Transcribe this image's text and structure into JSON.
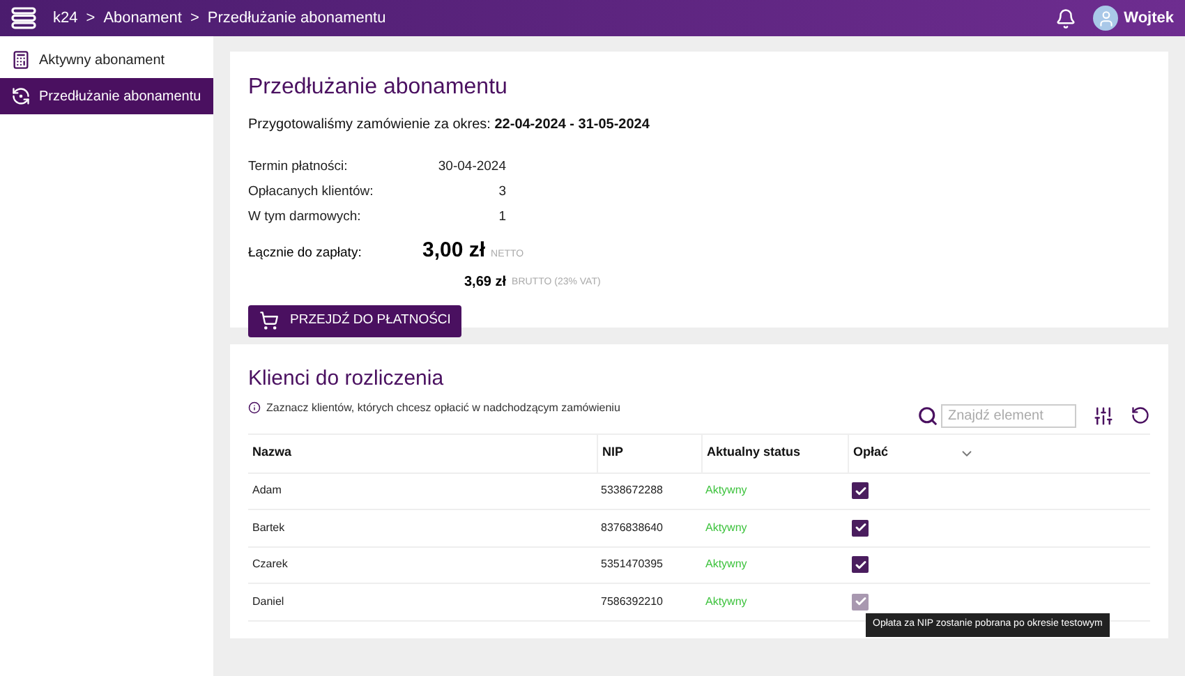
{
  "header": {
    "breadcrumbs": [
      "k24",
      "Abonament",
      "Przedłużanie abonamentu"
    ],
    "separator": ">",
    "user": "Wojtek"
  },
  "sidebar": {
    "items": [
      {
        "label": "Aktywny abonament",
        "selected": false
      },
      {
        "label": "Przedłużanie abonamentu",
        "selected": true
      }
    ]
  },
  "summary": {
    "title": "Przedłużanie abonamentu",
    "period_label": "Przygotowaliśmy zamówienie za okres:",
    "period": "22-04-2024 - 31-05-2024",
    "rows": [
      {
        "label": "Termin płatności:",
        "value": "30-04-2024"
      },
      {
        "label": "Opłacanych klientów:",
        "value": "3"
      },
      {
        "label": "W tym darmowych:",
        "value": "1"
      }
    ],
    "total_label": "Łącznie do zapłaty:",
    "net": "3,00 zł",
    "net_note": "NETTO",
    "gross": "3,69 zł",
    "gross_note": "BRUTTO (23% VAT)",
    "pay_button": "PRZEJDŹ DO PŁATNOŚCI"
  },
  "clients": {
    "title": "Klienci do rozliczenia",
    "hint": "Zaznacz klientów, których chcesz opłacić w nadchodzącym zamówieniu",
    "search_placeholder": "Znajdź element",
    "columns": [
      "Nazwa",
      "NIP",
      "Aktualny status",
      "Opłać"
    ],
    "rows": [
      {
        "name": "Adam",
        "nip": "5338672288",
        "status": "Aktywny",
        "checked": true,
        "disabled": false
      },
      {
        "name": "Bartek",
        "nip": "8376838640",
        "status": "Aktywny",
        "checked": true,
        "disabled": false
      },
      {
        "name": "Czarek",
        "nip": "5351470395",
        "status": "Aktywny",
        "checked": true,
        "disabled": false
      },
      {
        "name": "Daniel",
        "nip": "7586392210",
        "status": "Aktywny",
        "checked": true,
        "disabled": true
      }
    ],
    "tooltip": "Opłata za NIP zostanie pobrana po okresie testowym"
  }
}
